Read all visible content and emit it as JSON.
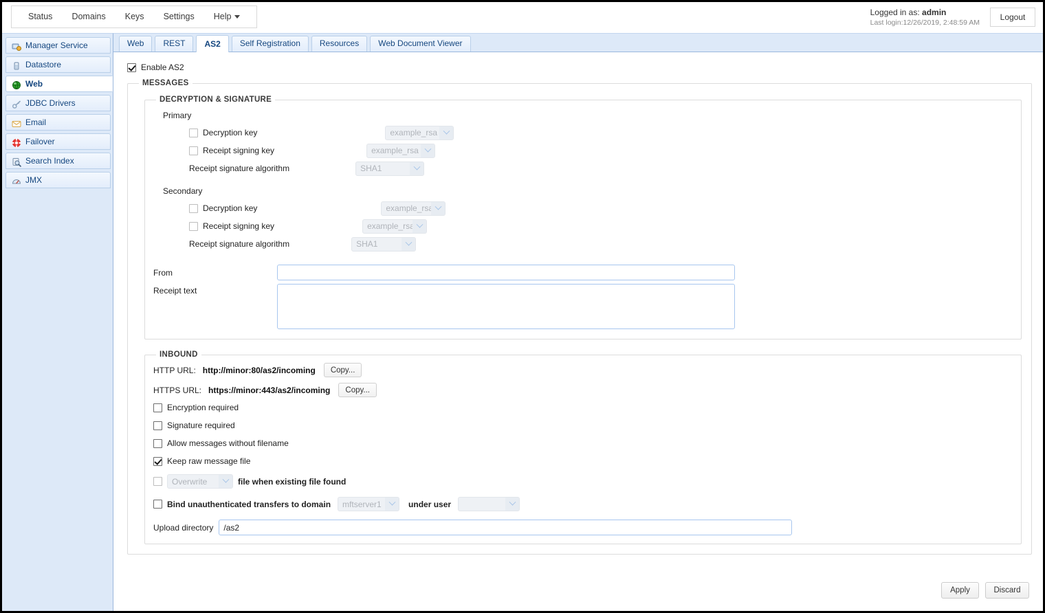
{
  "topbar": {
    "menu": [
      {
        "label": "Status",
        "icon": null
      },
      {
        "label": "Domains",
        "icon": null
      },
      {
        "label": "Keys",
        "icon": null
      },
      {
        "label": "Settings",
        "icon": null
      },
      {
        "label": "Help",
        "icon": "caret-down-icon"
      }
    ],
    "logged_in_prefix": "Logged in as: ",
    "logged_in_user": "admin",
    "last_login": "Last login:12/26/2019, 2:48:59 AM",
    "logout_label": "Logout"
  },
  "sidebar": {
    "items": [
      {
        "label": "Manager Service",
        "icon": "manager-service-icon",
        "active": false
      },
      {
        "label": "Datastore",
        "icon": "datastore-icon",
        "active": false
      },
      {
        "label": "Web",
        "icon": "web-globe-icon",
        "active": true
      },
      {
        "label": "JDBC Drivers",
        "icon": "jdbc-drivers-icon",
        "active": false
      },
      {
        "label": "Email",
        "icon": "email-icon",
        "active": false
      },
      {
        "label": "Failover",
        "icon": "failover-icon",
        "active": false
      },
      {
        "label": "Search Index",
        "icon": "search-index-icon",
        "active": false
      },
      {
        "label": "JMX",
        "icon": "jmx-icon",
        "active": false
      }
    ]
  },
  "tabs": [
    {
      "label": "Web",
      "active": false
    },
    {
      "label": "REST",
      "active": false
    },
    {
      "label": "AS2",
      "active": true
    },
    {
      "label": "Self Registration",
      "active": false
    },
    {
      "label": "Resources",
      "active": false
    },
    {
      "label": "Web Document Viewer",
      "active": false
    }
  ],
  "form": {
    "enable_as2": {
      "label": "Enable AS2",
      "checked": true
    },
    "messages_legend": "MESSAGES",
    "decryption_legend": "DECRYPTION & SIGNATURE",
    "primary": {
      "group_label": "Primary",
      "decryption_key": {
        "label": "Decryption key",
        "checked": false,
        "select_value": "example_rsa",
        "disabled": true
      },
      "receipt_signing_key": {
        "label": "Receipt signing key",
        "checked": false,
        "select_value": "example_rsa",
        "disabled": true
      },
      "receipt_signature_algorithm": {
        "label": "Receipt signature algorithm",
        "select_value": "SHA1",
        "disabled": true
      }
    },
    "secondary": {
      "group_label": "Secondary",
      "decryption_key": {
        "label": "Decryption key",
        "checked": false,
        "select_value": "example_rsa",
        "disabled": true
      },
      "receipt_signing_key": {
        "label": "Receipt signing key",
        "checked": false,
        "select_value": "example_rsa",
        "disabled": true
      },
      "receipt_signature_algorithm": {
        "label": "Receipt signature algorithm",
        "select_value": "SHA1",
        "disabled": true
      }
    },
    "from": {
      "label": "From",
      "value": "",
      "placeholder": ""
    },
    "receipt_text": {
      "label": "Receipt text",
      "value": "",
      "placeholder": ""
    },
    "inbound": {
      "legend": "INBOUND",
      "http_url_label": "HTTP URL:",
      "http_url_value": "http://minor:80/as2/incoming",
      "http_copy_label": "Copy...",
      "https_url_label": "HTTPS URL:",
      "https_url_value": "https://minor:443/as2/incoming",
      "https_copy_label": "Copy...",
      "encryption_required": {
        "label": "Encryption required",
        "checked": false
      },
      "signature_required": {
        "label": "Signature required",
        "checked": false
      },
      "allow_no_filename": {
        "label": "Allow messages without filename",
        "checked": false
      },
      "keep_raw_message_file": {
        "label": "Keep raw message file",
        "checked": true
      },
      "existing_file": {
        "checked": false,
        "select_value": "Overwrite",
        "suffix_label": "file when existing file found",
        "disabled": true
      },
      "bind_transfers": {
        "checked": false,
        "label": "Bind unauthenticated transfers to domain",
        "domain_value": "mftserver1",
        "under_user_label": "under user",
        "user_value": "",
        "disabled": true
      },
      "upload_directory": {
        "label": "Upload directory",
        "value": "/as2"
      }
    }
  },
  "actions": {
    "apply_label": "Apply",
    "discard_label": "Discard"
  },
  "colors": {
    "sidebar_bg": "#dde9f8",
    "tab_border": "#b9cfe9",
    "link_text": "#14467f",
    "input_border": "#a7c6ef"
  }
}
